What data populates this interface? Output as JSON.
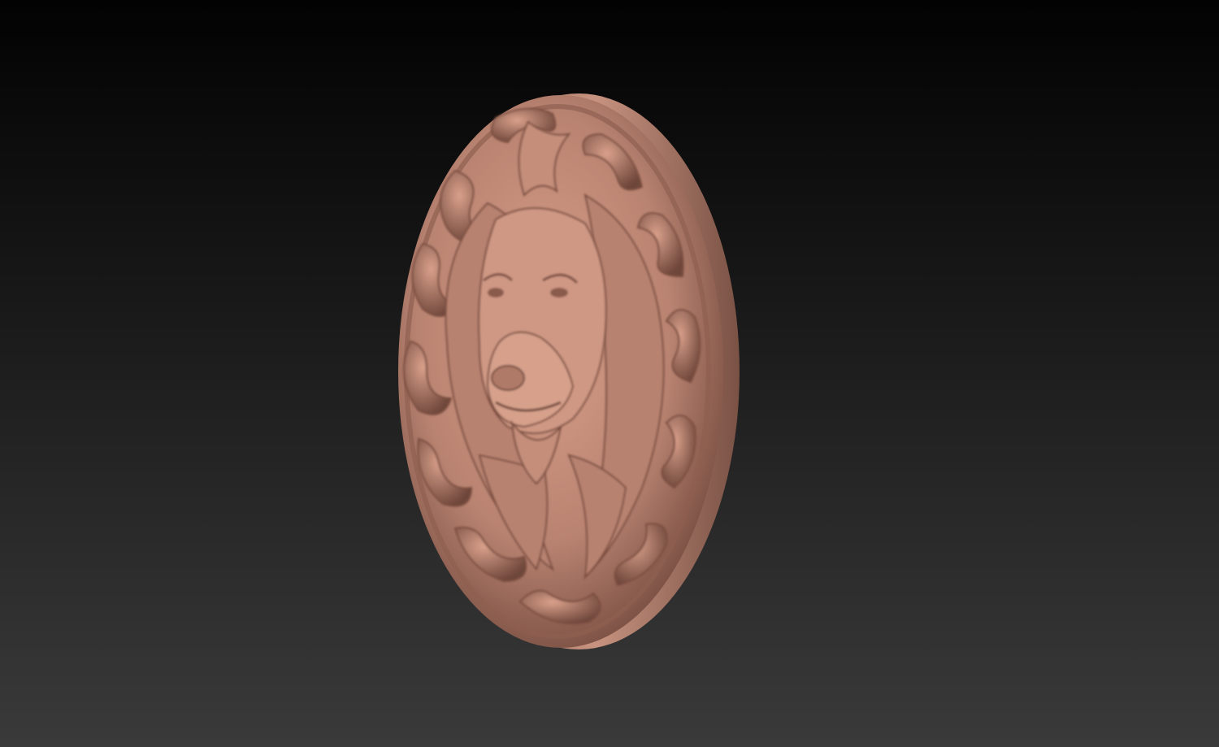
{
  "scene": {
    "subject_icon": "lion-head-medallion-icon",
    "colors": {
      "background_top": "#020202",
      "background_bottom": "#3a3a3a",
      "relief_light": "#d9a08b",
      "relief_mid": "#b98371",
      "relief_shadow": "#6e463a",
      "rim_light": "#c89380",
      "rim_dark": "#7a5245"
    }
  }
}
